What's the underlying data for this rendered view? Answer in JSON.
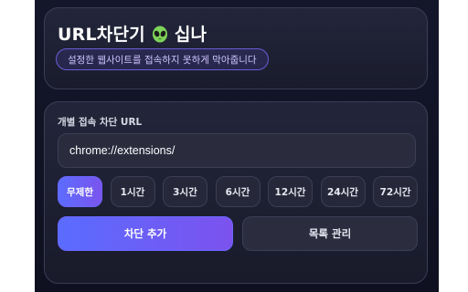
{
  "header": {
    "title": "URL차단기",
    "title_suffix": "십나",
    "icon": "alien-icon",
    "subtitle": "설정한 웹사이트를 접속하지 못하게 막아줍니다"
  },
  "block_form": {
    "section_label": "개별 접속 차단 URL",
    "url_value": "chrome://extensions/",
    "durations": [
      {
        "label": "무제한",
        "active": true
      },
      {
        "label": "1시간",
        "active": false
      },
      {
        "label": "3시간",
        "active": false
      },
      {
        "label": "6시간",
        "active": false
      },
      {
        "label": "12시간",
        "active": false
      },
      {
        "label": "24시간",
        "active": false
      },
      {
        "label": "72시간",
        "active": false
      }
    ],
    "add_button_label": "차단 추가",
    "manage_button_label": "목록 관리"
  },
  "colors": {
    "accent_start": "#5a6cff",
    "accent_end": "#7c52ee",
    "background": "#111324",
    "alien_green": "#7fd35a"
  }
}
